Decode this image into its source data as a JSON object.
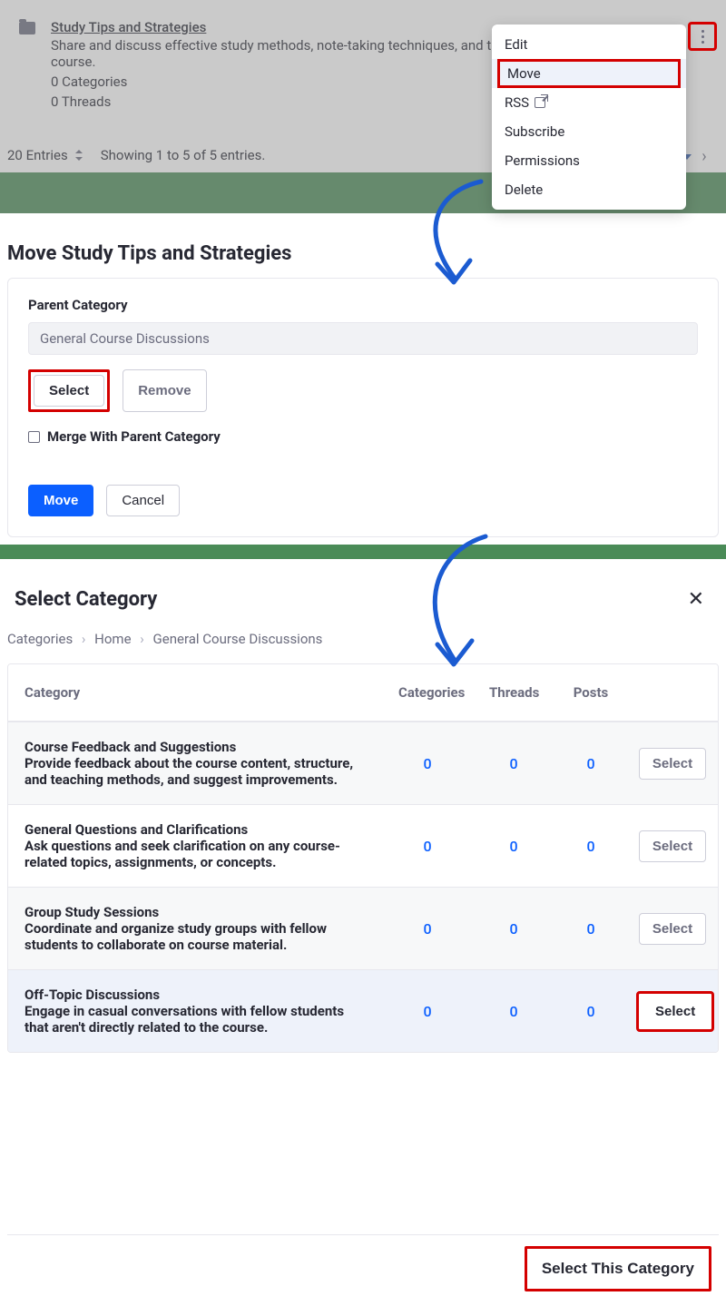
{
  "panel1": {
    "category_title": "Study Tips and Strategies",
    "category_description": "Share and discuss effective study methods, note-taking techniques, and tim course.",
    "counts_categories": "0 Categories",
    "counts_threads": "0 Threads",
    "entries_count": "20 Entries",
    "showing_text": "Showing 1 to 5 of 5 entries."
  },
  "dropdown": {
    "edit": "Edit",
    "move": "Move",
    "rss": "RSS",
    "subscribe": "Subscribe",
    "permissions": "Permissions",
    "delete": "Delete"
  },
  "panel2": {
    "title": "Move Study Tips and Strategies",
    "parent_label": "Parent Category",
    "parent_value": "General Course Discussions",
    "select_btn": "Select",
    "remove_btn": "Remove",
    "merge_label": "Merge With Parent Category",
    "move_btn": "Move",
    "cancel_btn": "Cancel"
  },
  "panel3": {
    "title": "Select Category",
    "crumb1": "Categories",
    "crumb2": "Home",
    "crumb3": "General Course Discussions",
    "col_category": "Category",
    "col_categories": "Categories",
    "col_threads": "Threads",
    "col_posts": "Posts",
    "select_label": "Select",
    "footer_btn": "Select This Category",
    "rows": [
      {
        "title": "Course Feedback and Suggestions",
        "desc": "Provide feedback about the course content, structure, and teaching methods, and suggest improvements.",
        "cats": "0",
        "threads": "0",
        "posts": "0"
      },
      {
        "title": "General Questions and Clarifications",
        "desc": "Ask questions and seek clarification on any course-related topics, assignments, or concepts.",
        "cats": "0",
        "threads": "0",
        "posts": "0"
      },
      {
        "title": "Group Study Sessions",
        "desc": "Coordinate and organize study groups with fellow students to collaborate on course material.",
        "cats": "0",
        "threads": "0",
        "posts": "0"
      },
      {
        "title": "Off-Topic Discussions",
        "desc": "Engage in casual conversations with fellow students that aren't directly related to the course.",
        "cats": "0",
        "threads": "0",
        "posts": "0"
      }
    ]
  }
}
